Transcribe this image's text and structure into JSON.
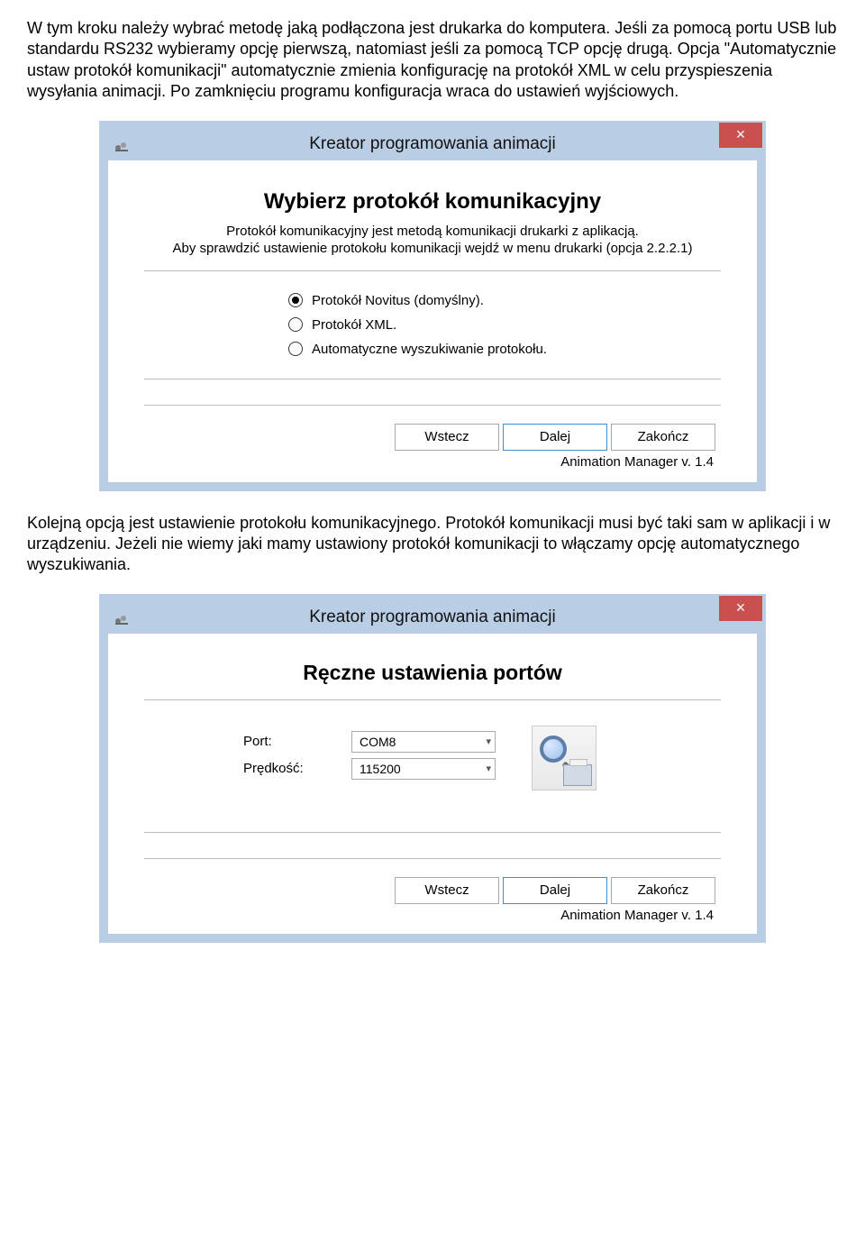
{
  "paragraph1": "W tym kroku należy wybrać metodę jaką podłączona jest drukarka do komputera. Jeśli za pomocą portu USB lub standardu RS232 wybieramy opcję pierwszą, natomiast jeśli za pomocą TCP opcję drugą. Opcja \"Automatycznie ustaw protokół komunikacji\" automatycznie zmienia konfigurację na protokół XML w celu przyspieszenia wysyłania animacji. Po zamknięciu programu konfiguracja wraca do ustawień wyjściowych.",
  "paragraph2": "Kolejną opcją jest ustawienie protokołu komunikacyjnego. Protokół komunikacji musi być taki sam w aplikacji i w urządzeniu. Jeżeli nie wiemy jaki mamy ustawiony protokół komunikacji to włączamy opcję automatycznego wyszukiwania.",
  "dialog1": {
    "title": "Kreator programowania animacji",
    "close": "×",
    "heading": "Wybierz protokół komunikacyjny",
    "sub1": "Protokół komunikacyjny jest metodą komunikacji drukarki z aplikacją.",
    "sub2": "Aby sprawdzić ustawienie protokołu komunikacji wejdź w menu drukarki (opcja 2.2.2.1)",
    "options": {
      "o1": "Protokół Novitus (domyślny).",
      "o2": "Protokół XML.",
      "o3": "Automatyczne wyszukiwanie protokołu."
    },
    "buttons": {
      "back": "Wstecz",
      "next": "Dalej",
      "finish": "Zakończ"
    },
    "version": "Animation Manager v. 1.4"
  },
  "dialog2": {
    "title": "Kreator programowania animacji",
    "close": "×",
    "heading": "Ręczne ustawienia portów",
    "port_label": "Port:",
    "port_value": "COM8",
    "speed_label": "Prędkość:",
    "speed_value": "115200",
    "buttons": {
      "back": "Wstecz",
      "next": "Dalej",
      "finish": "Zakończ"
    },
    "version": "Animation Manager v. 1.4"
  }
}
